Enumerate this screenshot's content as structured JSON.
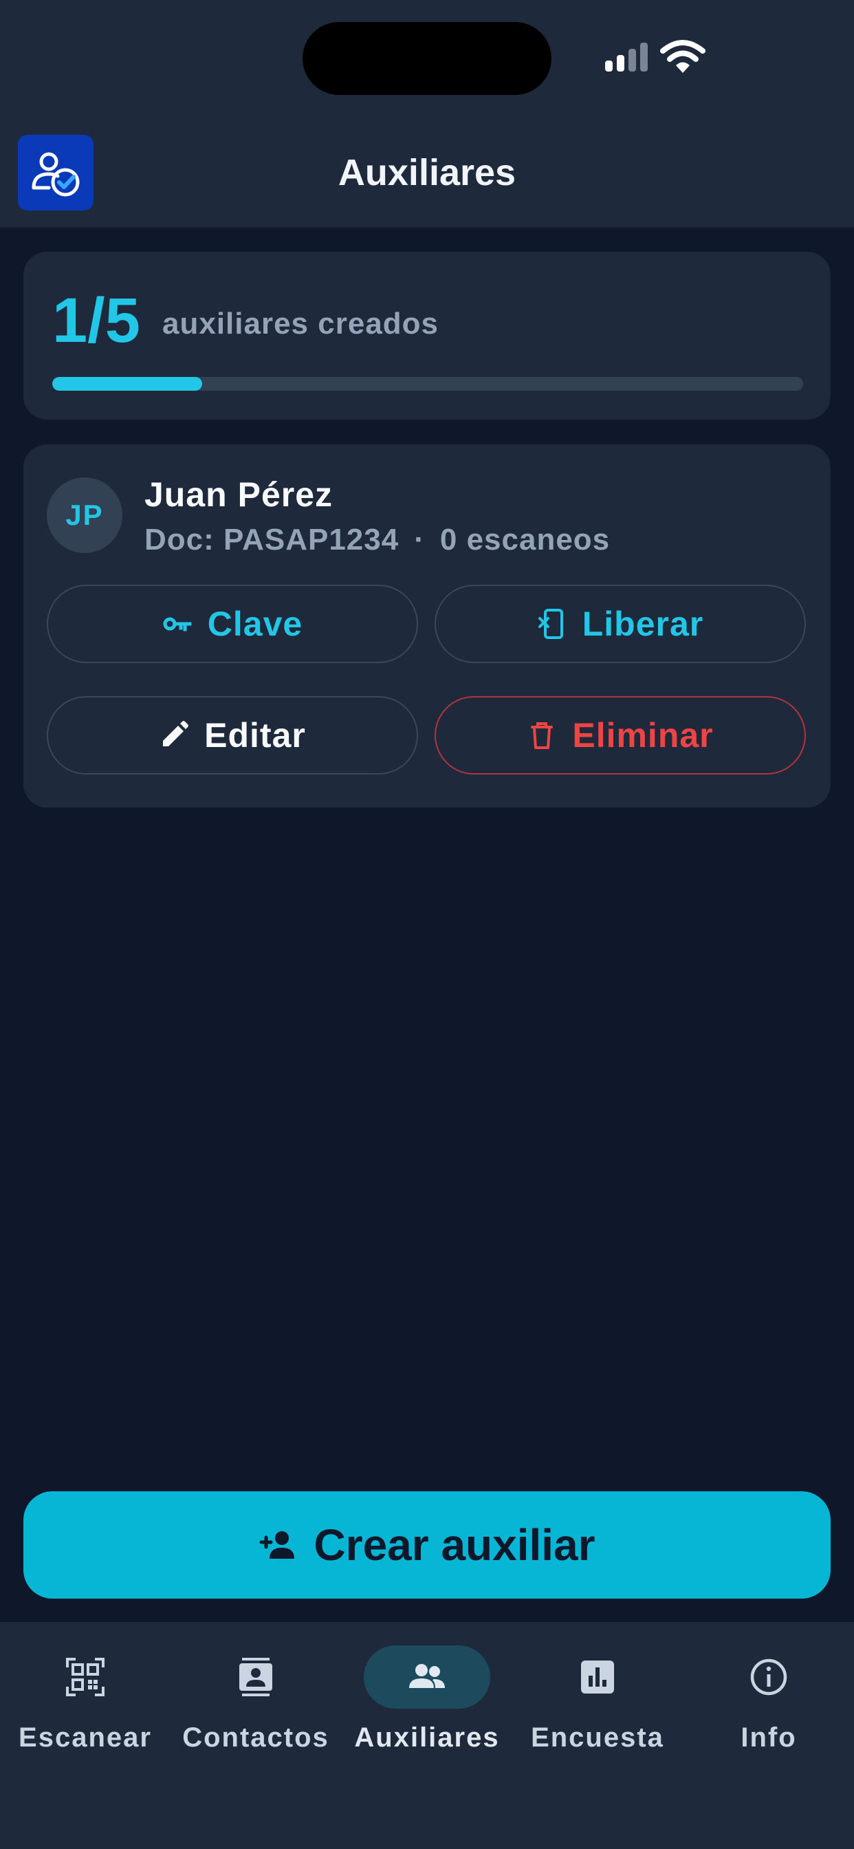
{
  "header": {
    "title": "Auxiliares"
  },
  "progress": {
    "count": "1/5",
    "label": "auxiliares creados",
    "fraction": 0.2,
    "color": "#22c6e6"
  },
  "auxiliar": {
    "initials": "JP",
    "name": "Juan Pérez",
    "document": "Doc: PASAP1234",
    "separator": "·",
    "scans": "0 escaneos",
    "actions": {
      "clave": "Clave",
      "liberar": "Liberar",
      "editar": "Editar",
      "eliminar": "Eliminar"
    }
  },
  "cta": {
    "label": "Crear auxiliar"
  },
  "nav": [
    {
      "label": "Escanear",
      "icon": "qr-code-icon"
    },
    {
      "label": "Contactos",
      "icon": "contacts-icon"
    },
    {
      "label": "Auxiliares",
      "icon": "group-icon",
      "active": true
    },
    {
      "label": "Encuesta",
      "icon": "poll-icon"
    },
    {
      "label": "Info",
      "icon": "info-icon"
    }
  ],
  "colors": {
    "accent": "#22c6e6",
    "danger": "#ef4444",
    "background": "#0f172a",
    "surface": "#1e293b"
  }
}
